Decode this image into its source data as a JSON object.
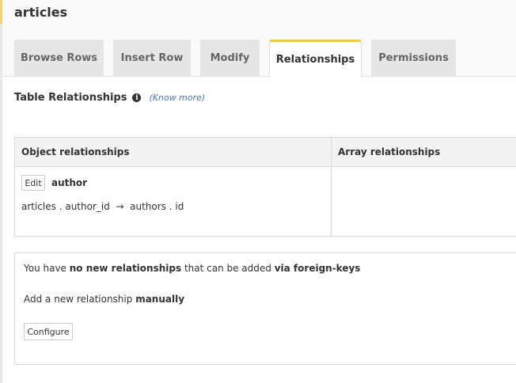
{
  "page": {
    "title": "articles"
  },
  "tabs": [
    {
      "label": "Browse Rows",
      "active": false
    },
    {
      "label": "Insert Row",
      "active": false
    },
    {
      "label": "Modify",
      "active": false
    },
    {
      "label": "Relationships",
      "active": true
    },
    {
      "label": "Permissions",
      "active": false
    }
  ],
  "section": {
    "title": "Table Relationships",
    "info_icon": "info-circle-icon",
    "know_more": "(Know more)"
  },
  "relationships_table": {
    "headers": {
      "object": "Object relationships",
      "array": "Array relationships"
    },
    "object_rows": [
      {
        "edit_label": "Edit",
        "name": "author",
        "mapping": "articles . author_id  →  authors . id"
      }
    ]
  },
  "suggestions": {
    "line1": {
      "pre": "You have ",
      "bold1": "no new relationships",
      "mid": " that can be added ",
      "bold2": "via foreign-keys"
    },
    "line2": {
      "pre": "Add a new relationship ",
      "bold": "manually"
    },
    "configure_label": "Configure"
  },
  "colors": {
    "tab_active_accent": "#f5c94d",
    "link": "#4a78c8",
    "rail_accent": "#f5d56b"
  }
}
